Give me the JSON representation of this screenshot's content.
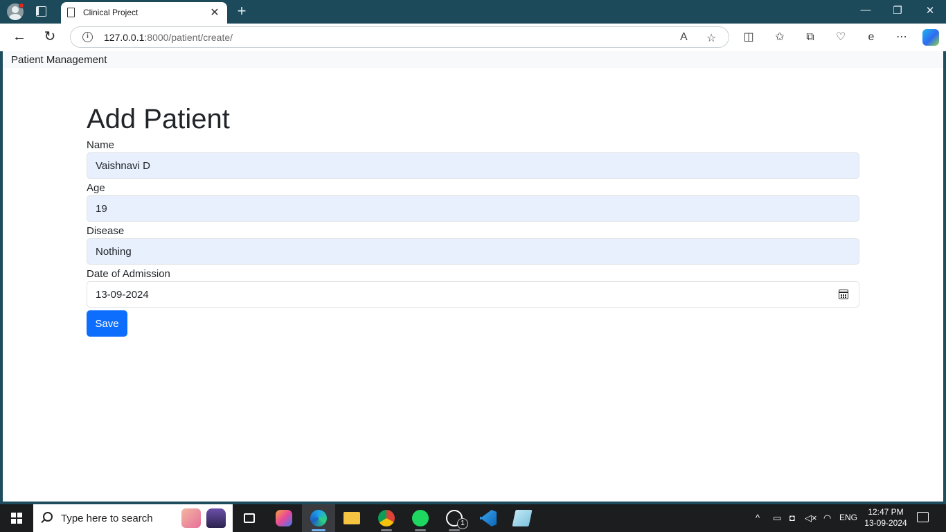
{
  "browser": {
    "tab_title": "Clinical Project",
    "tab_close": "✕",
    "new_tab": "+",
    "url_host": "127.0.0.1",
    "url_path": ":8000/patient/create/",
    "window_controls": {
      "minimize": "—",
      "restore": "❐",
      "close": "✕"
    }
  },
  "app": {
    "brand": "Patient Management"
  },
  "form": {
    "title": "Add Patient",
    "fields": [
      {
        "label": "Name",
        "value": "Vaishnavi D"
      },
      {
        "label": "Age",
        "value": "19"
      },
      {
        "label": "Disease",
        "value": "Nothing"
      },
      {
        "label": "Date of Admission",
        "value": "13-09-2024"
      }
    ],
    "save_label": "Save"
  },
  "taskbar": {
    "search_placeholder": "Type here to search",
    "whatsapp_badge": "1",
    "language": "ENG",
    "time": "12:47 PM",
    "date": "13-09-2024"
  },
  "colors": {
    "primary": "#0d6efd",
    "autofill": "#e8f0fe",
    "titlebar": "#1d4a5b"
  }
}
